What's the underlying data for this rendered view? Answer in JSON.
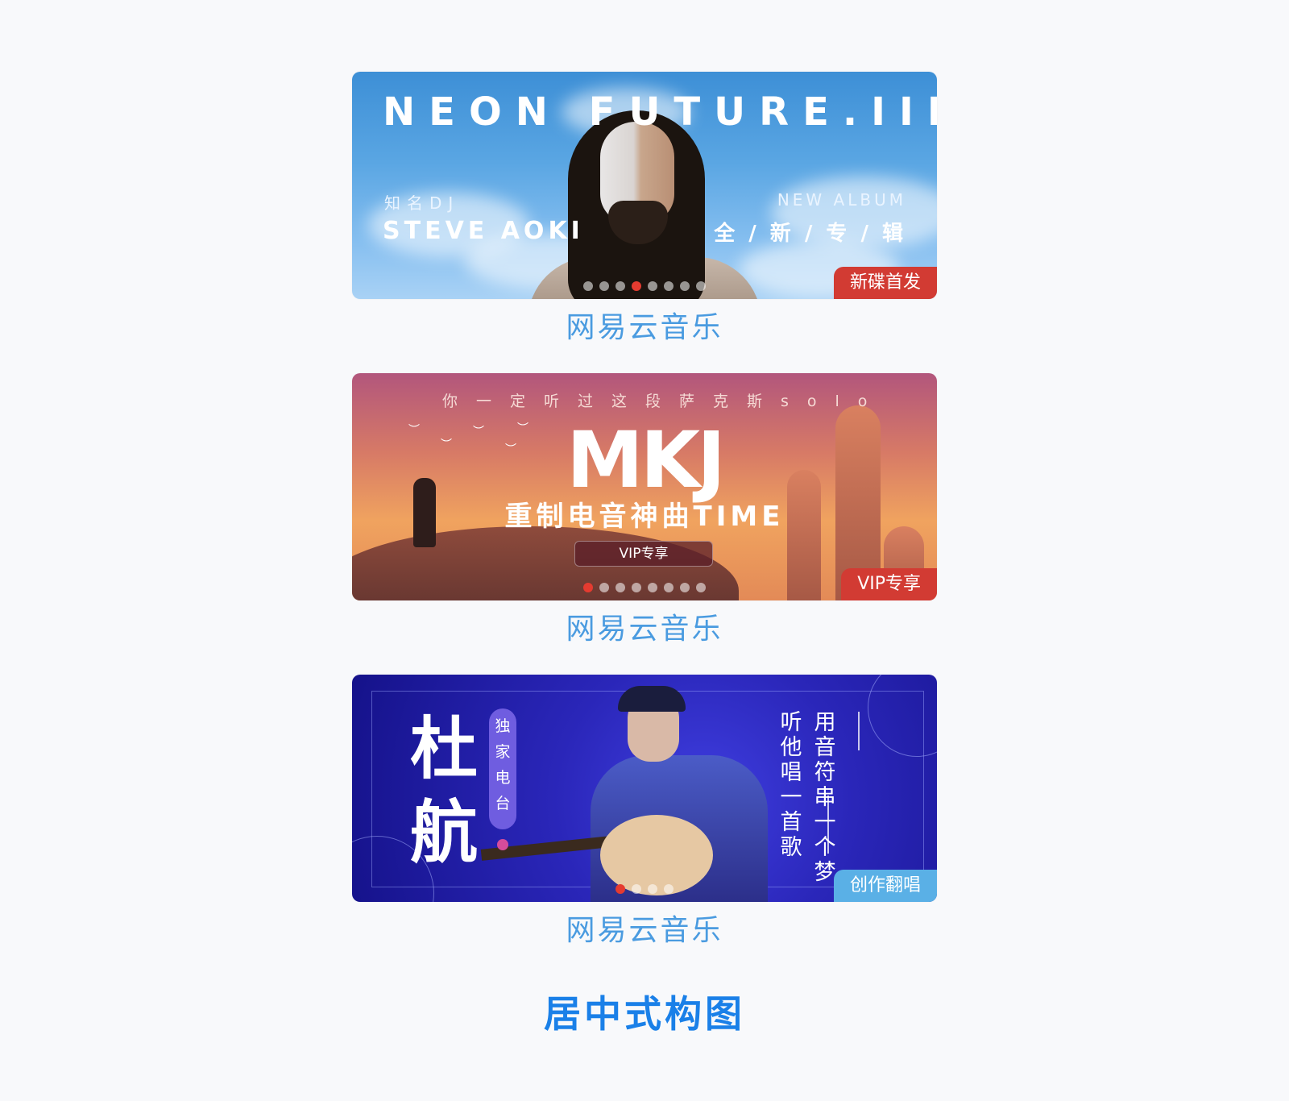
{
  "banners": [
    {
      "title": "NEON FUTURE.III",
      "subtitle_left_small": "知名DJ",
      "subtitle_left_large": "STEVE AOKI",
      "subtitle_right_small": "NEW ALBUM",
      "subtitle_right_large": "全 / 新 / 专 / 辑",
      "tag": "新碟首发",
      "tag_color": "#d23b33",
      "active_dot": 4,
      "dot_count": 8,
      "caption": "网易云音乐"
    },
    {
      "top_text": "你一定听过这段萨克斯solo",
      "headline": "MKJ",
      "subheadline": "重制电音神曲TIME",
      "button": "VIP专享",
      "tag": "VIP专享",
      "tag_color": "#d23b33",
      "active_dot": 1,
      "dot_count": 8,
      "caption": "网易云音乐"
    },
    {
      "name": "杜航",
      "side_label": "独家电台",
      "verse_col1": "听他唱一首歌",
      "verse_col2": "用音符串一个梦",
      "tag": "创作翻唱",
      "tag_color": "#5ab0e6",
      "active_dot": 1,
      "dot_count": 4,
      "caption": "网易云音乐"
    }
  ],
  "footer_title": "居中式构图",
  "accent_color": "#1a80e8"
}
